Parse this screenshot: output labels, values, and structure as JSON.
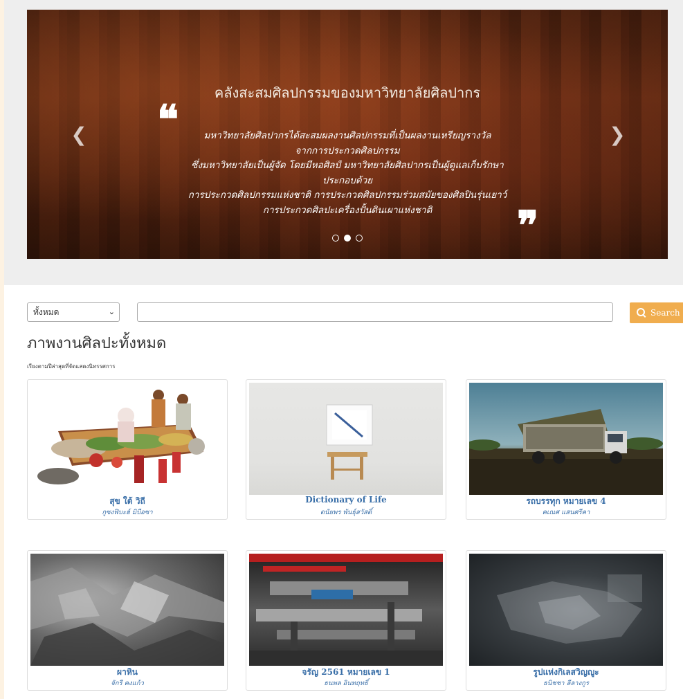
{
  "carousel": {
    "title": "คลังสะสมศิลปกรรมของมหาวิทยาลัยศิลปากร",
    "lines": [
      "มหาวิทยาลัยศิลปากรได้สะสมผลงานศิลปกรรมที่เป็นผลงานเหรียญรางวัล",
      "จากการประกวดศิลปกรรม",
      "ซึ่งมหาวิทยาลัยเป็นผู้จัด โดยมีหอศิลป์ มหาวิทยาลัยศิลปากรเป็นผู้ดูแลเก็บรักษา",
      "ประกอบด้วย",
      "การประกวดศิลปกรรมแห่งชาติ การประกวดศิลปกรรมร่วมสมัยของศิลปินรุ่นเยาว์",
      "การประกวดศิลปะเครื่องปั้นดินเผาแห่งชาติ"
    ],
    "quote_open": "❝",
    "quote_close": "❞",
    "prev_arrow": "❮",
    "next_arrow": "❯",
    "slides_total": 3,
    "active_slide": 2,
    "icons": [
      "chevron-left-icon",
      "chevron-right-icon",
      "quote-icon"
    ]
  },
  "search": {
    "category_selected": "ทั้งหมด",
    "chevron": "⌄",
    "input_value": "",
    "button_label": "Search",
    "button_color": "#f0ad4e"
  },
  "gallery": {
    "title": "ภาพงานศิลปะทั้งหมด",
    "subtitle": "เรียงตามปีล่าสุดที่จัดแสดงนิทรรศการ",
    "items": [
      {
        "title": "สุข ใต้ วิถี",
        "artist": "กูซงฟิบะฮ์ มิบือซา"
      },
      {
        "title": "Dictionary of Life",
        "artist": "ดนัยพร พันธุ์สวัสดิ์"
      },
      {
        "title": "รถบรรทุก หมายเลข 4",
        "artist": "คเณศ แสนศรีคา"
      },
      {
        "title": "ผาหิน",
        "artist": "จักรี คงแก้ว"
      },
      {
        "title": "จรัญ 2561 หมายเลข 1",
        "artist": "ธนพล อินทฤทธิ์"
      },
      {
        "title": "รูปแห่งกิเลสวิญญูะ",
        "artist": "ธนิชชา ลีลางกูร"
      }
    ]
  },
  "colors": {
    "link_blue": "#3a6fa8",
    "page_border": "#fdf2e2"
  }
}
